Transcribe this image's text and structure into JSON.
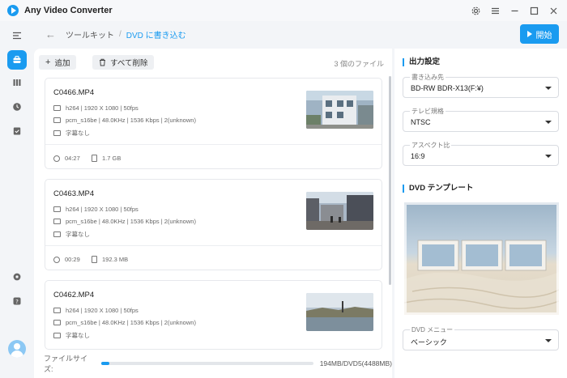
{
  "app": {
    "title": "Any Video Converter"
  },
  "window_controls": [
    "settings-icon",
    "menu-icon",
    "minimize-icon",
    "maximize-icon",
    "close-icon"
  ],
  "breadcrumb": {
    "parent": "ツールキット",
    "current": "DVD に書き込む"
  },
  "start_button": {
    "label": "開始"
  },
  "toolbar": {
    "add_label": "追加",
    "delete_all_label": "すべて削除",
    "file_count": "3 個のファイル"
  },
  "files": [
    {
      "name": "C0466.MP4",
      "video": "h264 | 1920 X 1080 | 50fps",
      "audio": "pcm_s16be | 48.0KHz | 1536 Kbps | 2(unknown)",
      "subtitle": "字幕なし",
      "duration": "04:27",
      "size": "1.7 GB"
    },
    {
      "name": "C0463.MP4",
      "video": "h264 | 1920 X 1080 | 50fps",
      "audio": "pcm_s16be | 48.0KHz | 1536 Kbps | 2(unknown)",
      "subtitle": "字幕なし",
      "duration": "00:29",
      "size": "192.3 MB"
    },
    {
      "name": "C0462.MP4",
      "video": "h264 | 1920 X 1080 | 50fps",
      "audio": "pcm_s16be | 48.0KHz | 1536 Kbps | 2(unknown)",
      "subtitle": "字幕なし"
    }
  ],
  "filesize": {
    "label": "ファイルサイズ:",
    "caption": "194MB/DVD5(4488MB)",
    "progress_fraction": 0.04
  },
  "output": {
    "title": "出力設定",
    "writer": {
      "label": "書き込み先",
      "value": "BD-RW BDR-X13(F:¥)"
    },
    "tv_standard": {
      "label": "テレビ規格",
      "value": "NTSC"
    },
    "aspect": {
      "label": "アスペクト比",
      "value": "16:9"
    }
  },
  "template": {
    "title": "DVD テンプレート",
    "menu": {
      "label": "DVD メニュー",
      "value": "ベーシック"
    }
  },
  "colors": {
    "accent": "#1a9bf0",
    "sidebar_bg": "#f3f5f8",
    "panel_bg": "#ffffff"
  }
}
